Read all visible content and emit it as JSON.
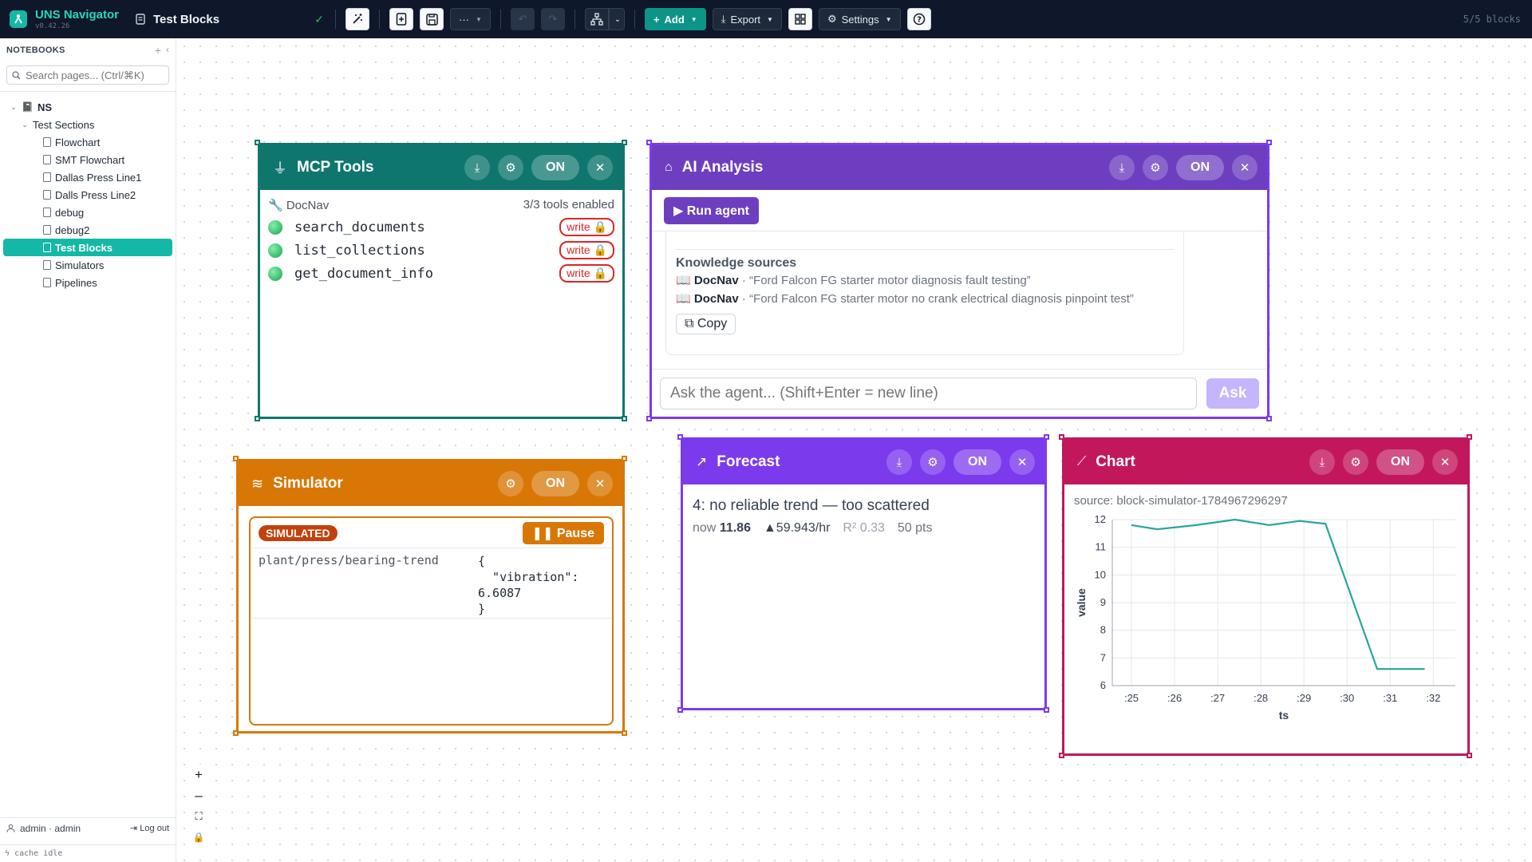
{
  "app": {
    "name": "UNS Navigator",
    "version": "v0.42.26"
  },
  "topbar": {
    "doc_title": "Test Blocks",
    "more_label": "···",
    "add_label": "Add",
    "export_label": "Export",
    "settings_label": "Settings",
    "block_count": "5/5 blocks"
  },
  "sidebar": {
    "title": "NOTEBOOKS",
    "search_placeholder": "Search pages... (Ctrl/⌘K)",
    "notebook": "NS",
    "section": "Test Sections",
    "pages": [
      "Flowchart",
      "SMT Flowchart",
      "Dallas Press Line1",
      "Dalls Press Line2",
      "debug",
      "debug2",
      "Test Blocks",
      "Simulators",
      "Pipelines"
    ],
    "active_page": "Test Blocks",
    "user": "admin · admin",
    "logout": "Log out",
    "cache": "cache idle"
  },
  "blocks": {
    "mcp": {
      "title": "MCP Tools",
      "on_label": "ON",
      "server": "🔧 DocNav",
      "enabled": "3/3 tools enabled",
      "tools": [
        {
          "name": "search_documents",
          "badge": "write 🔒"
        },
        {
          "name": "list_collections",
          "badge": "write 🔒"
        },
        {
          "name": "get_document_info",
          "badge": "write 🔒"
        }
      ]
    },
    "ai": {
      "title": "AI Analysis",
      "on_label": "ON",
      "run_label": "▶ Run agent",
      "ks_title": "Knowledge sources",
      "sources": [
        {
          "name": "DocNav",
          "text": " · “Ford Falcon FG starter motor diagnosis fault testing”"
        },
        {
          "name": "DocNav",
          "text": " · “Ford Falcon FG starter motor no crank electrical diagnosis pinpoint test”"
        }
      ],
      "copy_label": "⧉ Copy",
      "ask_placeholder": "Ask the agent... (Shift+Enter = new line)",
      "ask_label": "Ask"
    },
    "sim": {
      "title": "Simulator",
      "on_label": "ON",
      "badge": "SIMULATED",
      "pause_label": "❚❚ Pause",
      "topic": "plant/press/bearing-trend",
      "payload": "{\n  \"vibration\":\n6.6087\n}"
    },
    "forecast": {
      "title": "Forecast",
      "on_label": "ON",
      "message": "4: no reliable trend — too scattered",
      "now_label": "now",
      "now_value": "11.86",
      "rate": "▲59.943/hr",
      "r2": "R² 0.33",
      "pts": "50 pts"
    },
    "chart": {
      "title": "Chart",
      "on_label": "ON",
      "source": "source: block-simulator-1784967296297"
    }
  },
  "colors": {
    "mcp": "#0f766e",
    "ai": "#6d3fc0",
    "sim": "#d97706",
    "forecast": "#7c3aed",
    "chart": "#c2185b",
    "line": "#26a69a"
  },
  "chart_data": {
    "type": "line",
    "title": "",
    "xlabel": "ts",
    "ylabel": "value",
    "x": [
      ":25",
      ":26",
      ":27",
      ":28",
      ":29",
      ":30",
      ":31",
      ":32"
    ],
    "series": [
      {
        "points": [
          [
            0,
            11.8
          ],
          [
            0.6,
            11.65
          ],
          [
            1.5,
            11.8
          ],
          [
            2.4,
            12.0
          ],
          [
            3.2,
            11.8
          ],
          [
            3.9,
            11.95
          ],
          [
            4.5,
            11.85
          ],
          [
            5.7,
            6.6
          ],
          [
            6.8,
            6.6
          ]
        ]
      }
    ],
    "ylim": [
      6,
      12
    ],
    "yticks": [
      6,
      7,
      8,
      9,
      10,
      11,
      12
    ],
    "grid": true
  }
}
